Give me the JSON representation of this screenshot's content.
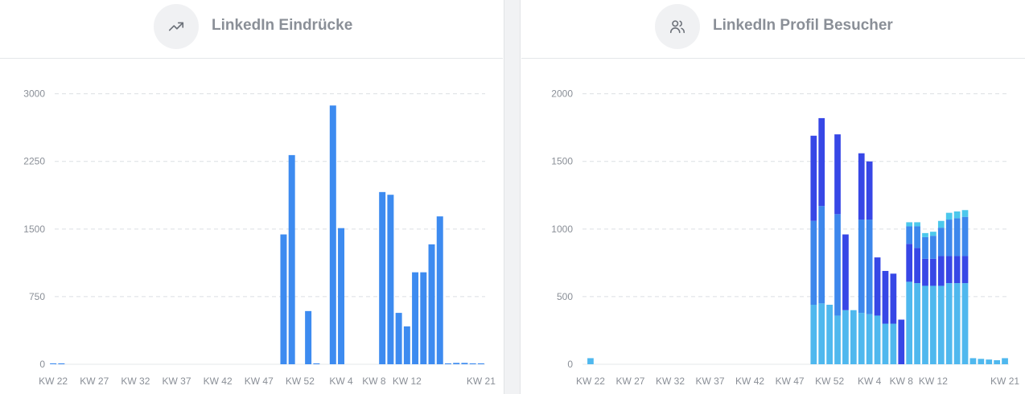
{
  "colors": {
    "impressions_bar": "#3d8bf0",
    "visitors_light": "#4fb8ee",
    "visitors_mid": "#3d87ec",
    "visitors_dark": "#3747e6",
    "visitors_cyan": "#4cc8ec",
    "grid": "#dcdfe3",
    "axis_text": "#8a8f97"
  },
  "panels": {
    "left": {
      "title": "LinkedIn Eindrücke",
      "icon": "trending-up-icon"
    },
    "right": {
      "title": "LinkedIn Profil Besucher",
      "icon": "users-icon"
    }
  },
  "chart_data": [
    {
      "type": "bar",
      "title": "LinkedIn Eindrücke",
      "x": [
        22,
        23,
        24,
        25,
        26,
        27,
        28,
        29,
        30,
        31,
        32,
        33,
        34,
        35,
        36,
        37,
        38,
        39,
        40,
        41,
        42,
        43,
        44,
        45,
        46,
        47,
        48,
        49,
        50,
        51,
        52,
        53,
        1,
        2,
        3,
        4,
        5,
        6,
        7,
        8,
        9,
        10,
        11,
        12,
        13,
        14,
        15,
        16,
        17,
        18,
        19,
        20,
        21
      ],
      "tick_labels": [
        {
          "x": 22,
          "label": "KW 22"
        },
        {
          "x": 27,
          "label": "KW 27"
        },
        {
          "x": 32,
          "label": "KW 32"
        },
        {
          "x": 37,
          "label": "KW 37"
        },
        {
          "x": 42,
          "label": "KW 42"
        },
        {
          "x": 47,
          "label": "KW 47"
        },
        {
          "x": 52,
          "label": "KW 52"
        },
        {
          "x": 4,
          "label": "KW 4"
        },
        {
          "x": 8,
          "label": "KW 8"
        },
        {
          "x": 12,
          "label": "KW 12"
        },
        {
          "x": 21,
          "label": "KW 21"
        }
      ],
      "yticks": [
        "0",
        "750",
        "1500",
        "2250",
        "3000"
      ],
      "ylim": [
        0,
        3300
      ],
      "grid": true,
      "series": [
        {
          "values": [
            10,
            10,
            0,
            0,
            0,
            0,
            0,
            0,
            0,
            0,
            0,
            0,
            0,
            0,
            0,
            0,
            0,
            0,
            0,
            0,
            0,
            0,
            0,
            0,
            0,
            0,
            0,
            0,
            1440,
            2320,
            0,
            590,
            10,
            0,
            2870,
            1510,
            0,
            0,
            0,
            0,
            1910,
            1880,
            570,
            420,
            1020,
            1020,
            1330,
            1640,
            10,
            15,
            15,
            10,
            10
          ]
        }
      ]
    },
    {
      "type": "bar",
      "title": "LinkedIn Profil Besucher",
      "stacked": true,
      "x": [
        22,
        23,
        24,
        25,
        26,
        27,
        28,
        29,
        30,
        31,
        32,
        33,
        34,
        35,
        36,
        37,
        38,
        39,
        40,
        41,
        42,
        43,
        44,
        45,
        46,
        47,
        48,
        49,
        50,
        51,
        52,
        53,
        1,
        2,
        3,
        4,
        5,
        6,
        7,
        8,
        9,
        10,
        11,
        12,
        13,
        14,
        15,
        16,
        17,
        18,
        19,
        20,
        21
      ],
      "tick_labels": [
        {
          "x": 22,
          "label": "KW 22"
        },
        {
          "x": 27,
          "label": "KW 27"
        },
        {
          "x": 32,
          "label": "KW 32"
        },
        {
          "x": 37,
          "label": "KW 37"
        },
        {
          "x": 42,
          "label": "KW 42"
        },
        {
          "x": 47,
          "label": "KW 47"
        },
        {
          "x": 52,
          "label": "KW 52"
        },
        {
          "x": 4,
          "label": "KW 4"
        },
        {
          "x": 8,
          "label": "KW 8"
        },
        {
          "x": 12,
          "label": "KW 12"
        },
        {
          "x": 21,
          "label": "KW 21"
        }
      ],
      "yticks": [
        "0",
        "500",
        "1000",
        "1500",
        "2000"
      ],
      "ylim": [
        0,
        2200
      ],
      "grid": true,
      "series": [
        {
          "color": "#4fb8ee",
          "values": [
            45,
            0,
            0,
            0,
            0,
            0,
            0,
            0,
            0,
            0,
            0,
            0,
            0,
            0,
            0,
            0,
            0,
            0,
            0,
            0,
            0,
            0,
            0,
            0,
            0,
            0,
            0,
            0,
            440,
            450,
            440,
            360,
            400,
            400,
            380,
            370,
            360,
            300,
            300,
            0,
            610,
            600,
            580,
            580,
            580,
            600,
            600,
            600,
            45,
            40,
            35,
            30,
            45
          ]
        },
        {
          "color": "#3d87ec",
          "values": [
            0,
            0,
            0,
            0,
            0,
            0,
            0,
            0,
            0,
            0,
            0,
            0,
            0,
            0,
            0,
            0,
            0,
            0,
            0,
            0,
            0,
            0,
            0,
            0,
            0,
            0,
            0,
            0,
            620,
            720,
            0,
            750,
            0,
            0,
            690,
            700,
            0,
            0,
            0,
            0,
            0,
            0,
            0,
            0,
            0,
            0,
            0,
            0,
            0,
            0,
            0,
            0,
            0
          ]
        },
        {
          "color": "#3747e6",
          "values": [
            0,
            0,
            0,
            0,
            0,
            0,
            0,
            0,
            0,
            0,
            0,
            0,
            0,
            0,
            0,
            0,
            0,
            0,
            0,
            0,
            0,
            0,
            0,
            0,
            0,
            0,
            0,
            0,
            630,
            650,
            0,
            590,
            560,
            0,
            490,
            430,
            430,
            390,
            370,
            330,
            280,
            260,
            200,
            200,
            220,
            200,
            200,
            200,
            0,
            0,
            0,
            0,
            0
          ]
        },
        {
          "color": "#3d87ec",
          "values": [
            0,
            0,
            0,
            0,
            0,
            0,
            0,
            0,
            0,
            0,
            0,
            0,
            0,
            0,
            0,
            0,
            0,
            0,
            0,
            0,
            0,
            0,
            0,
            0,
            0,
            0,
            0,
            0,
            0,
            0,
            0,
            0,
            0,
            0,
            0,
            0,
            0,
            0,
            0,
            0,
            130,
            160,
            160,
            170,
            210,
            270,
            280,
            290,
            0,
            0,
            0,
            0,
            0
          ]
        },
        {
          "color": "#4cc8ec",
          "values": [
            0,
            0,
            0,
            0,
            0,
            0,
            0,
            0,
            0,
            0,
            0,
            0,
            0,
            0,
            0,
            0,
            0,
            0,
            0,
            0,
            0,
            0,
            0,
            0,
            0,
            0,
            0,
            0,
            0,
            0,
            0,
            0,
            0,
            0,
            0,
            0,
            0,
            0,
            0,
            0,
            30,
            30,
            30,
            30,
            50,
            50,
            50,
            50,
            0,
            0,
            0,
            0,
            0
          ]
        }
      ]
    }
  ]
}
